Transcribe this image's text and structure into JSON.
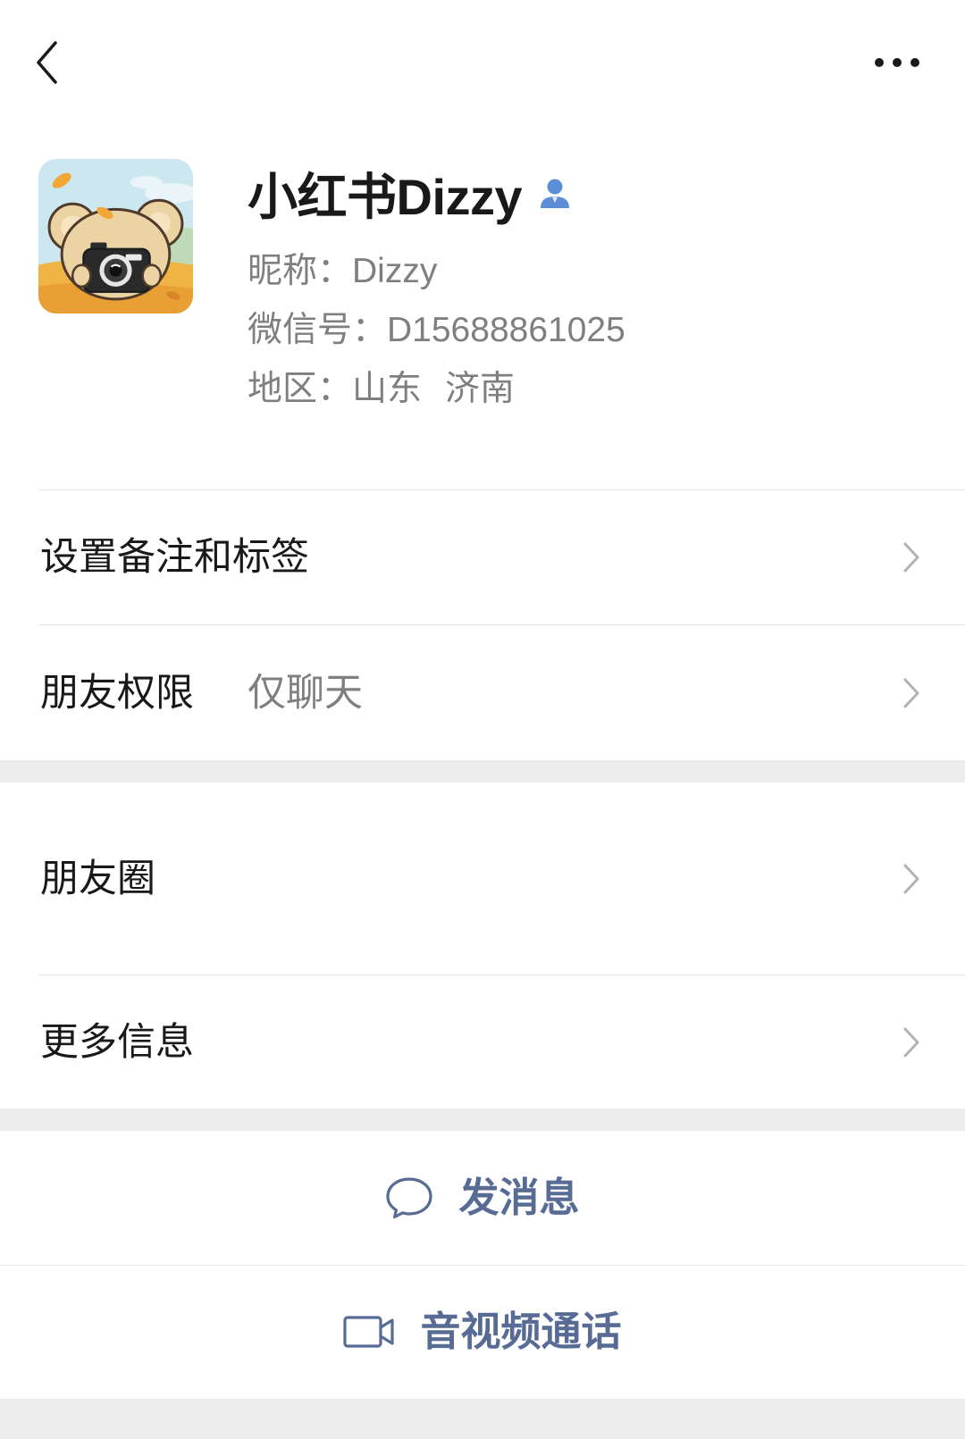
{
  "navbar": {
    "back_icon": "chevron-left-icon",
    "more_icon": "more-horizontal-icon"
  },
  "profile": {
    "avatar_icon": "bear-with-camera-avatar",
    "name": "小红书Dizzy",
    "badge_icon": "person-icon",
    "nickname_label": "昵称：",
    "nickname": "Dizzy",
    "wechat_id_label": "微信号：",
    "wechat_id": "D15688861025",
    "region_label": "地区：",
    "region_province": "山东",
    "region_city": "济南"
  },
  "menu": {
    "chevron_icon": "chevron-right-icon",
    "remarks_tags": {
      "label": "设置备注和标签"
    },
    "permissions": {
      "label": "朋友权限",
      "value": "仅聊天"
    },
    "moments": {
      "label": "朋友圈"
    },
    "more_info": {
      "label": "更多信息"
    }
  },
  "actions": {
    "message": {
      "label": "发消息",
      "icon": "chat-bubble-icon"
    },
    "call": {
      "label": "音视频通话",
      "icon": "video-camera-icon"
    }
  },
  "colors": {
    "background": "#ededed",
    "surface": "#ffffff",
    "text_primary": "#191919",
    "text_secondary": "#7f7f7f",
    "link": "#576b95",
    "badge": "#5b8ed6",
    "chevron": "#b2b2b2",
    "divider": "#e6e6e6"
  }
}
